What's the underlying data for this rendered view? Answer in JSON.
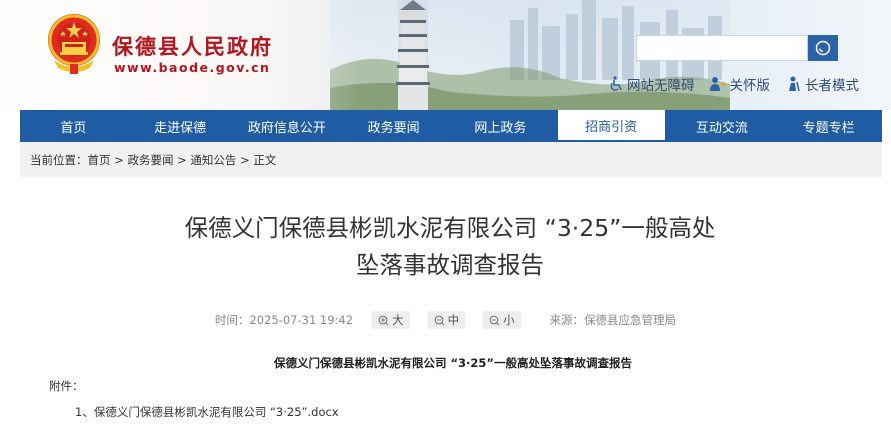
{
  "header": {
    "site_name": "保德县人民政府",
    "site_url": "www.baode.gov.cn",
    "search": {
      "placeholder": ""
    },
    "access_links": [
      {
        "label": "网站无障碍",
        "icon": "wheelchair-icon"
      },
      {
        "label": "关怀版",
        "icon": "person-heart-icon"
      },
      {
        "label": "长者模式",
        "icon": "elder-icon"
      }
    ]
  },
  "nav": {
    "items": [
      "首页",
      "走进保德",
      "政府信息公开",
      "政务要闻",
      "网上政务",
      "招商引资",
      "互动交流",
      "专题专栏"
    ],
    "active_index": 5
  },
  "breadcrumb": {
    "prefix": "当前位置：",
    "items": [
      "首页",
      "政务要闻",
      "通知公告",
      "正文"
    ],
    "separator": " > "
  },
  "article": {
    "title_line1": "保德义门保德县彬凯水泥有限公司 “3·25”一般高处",
    "title_line2": "坠落事故调查报告",
    "time_label": "时间：",
    "time_value": "2025-07-31 19:42",
    "font_sizes": [
      "大",
      "中",
      "小"
    ],
    "source_label": "来源：",
    "source_value": "保德县应急管理局",
    "doc_heading": "保德义门保德县彬凯水泥有限公司 “3·25”一般高处坠落事故调查报告",
    "attachment_label": "附件：",
    "attachments": [
      "1、保德义门保德县彬凯水泥有限公司 “3·25”.docx"
    ]
  },
  "colors": {
    "brand_red": "#b3151c",
    "nav_blue": "#1f5ca3",
    "search_blue": "#2c62a8"
  }
}
